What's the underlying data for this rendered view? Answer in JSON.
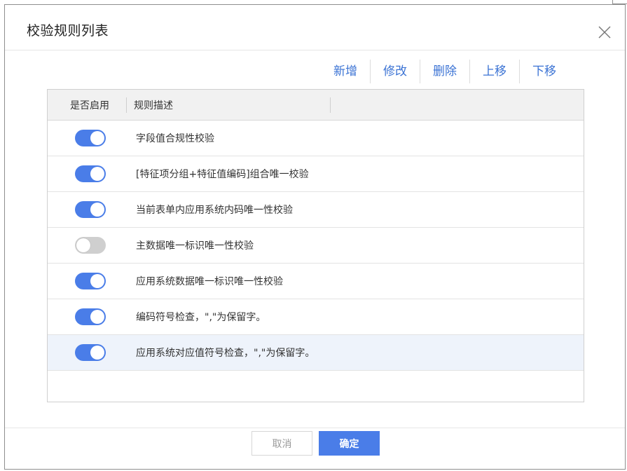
{
  "dialog": {
    "title": "校验规则列表",
    "close_icon": "close-icon"
  },
  "toolbar": {
    "add": "新增",
    "edit": "修改",
    "delete": "删除",
    "move_up": "上移",
    "move_down": "下移"
  },
  "grid": {
    "headers": {
      "enabled": "是否启用",
      "description": "规则描述"
    },
    "rows": [
      {
        "enabled": true,
        "description": "字段值合规性校验"
      },
      {
        "enabled": true,
        "description": "[特征项分组+特征值编码]组合唯一校验"
      },
      {
        "enabled": true,
        "description": "当前表单内应用系统内码唯一性校验"
      },
      {
        "enabled": false,
        "description": "主数据唯一标识唯一性校验"
      },
      {
        "enabled": true,
        "description": "应用系统数据唯一标识唯一性校验"
      },
      {
        "enabled": true,
        "description": "编码符号检查，\",\"为保留字。"
      },
      {
        "enabled": true,
        "description": "应用系统对应值符号检查，\",\"为保留字。",
        "selected": true
      }
    ]
  },
  "footer": {
    "cancel": "取消",
    "ok": "确定"
  },
  "colors": {
    "accent": "#4a7de8",
    "link": "#3b73d4",
    "toggle_off": "#cfcfcf"
  }
}
